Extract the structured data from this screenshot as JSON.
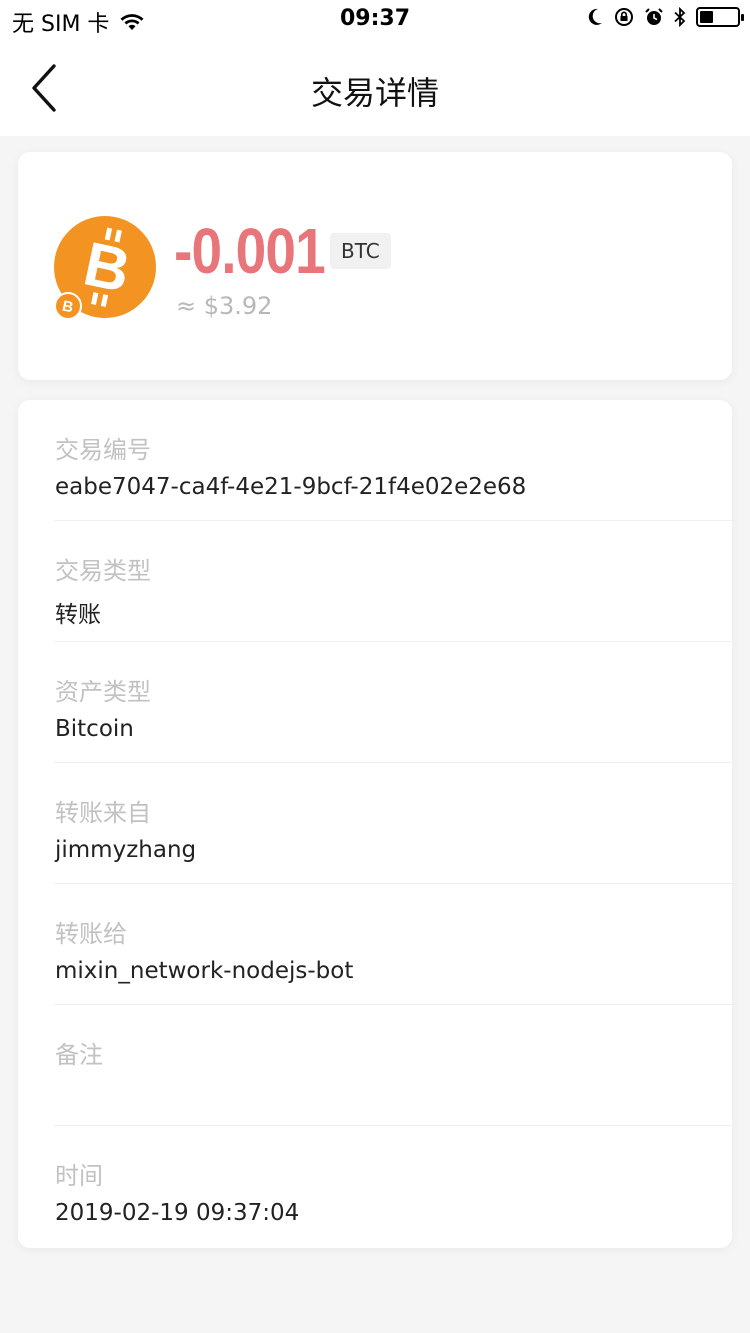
{
  "status_bar": {
    "carrier": "无 SIM 卡",
    "time": "09:37",
    "battery_level": 0.35,
    "icons": [
      "wifi-icon",
      "moon-icon",
      "orientation-lock-icon",
      "alarm-icon",
      "bluetooth-icon",
      "battery-icon"
    ]
  },
  "nav": {
    "title": "交易详情",
    "back_icon": "chevron-left-icon"
  },
  "asset": {
    "amount": "-0.001",
    "symbol": "BTC",
    "fiat": "≈ $3.92",
    "icon": "bitcoin-icon",
    "amount_color": "#e8757a",
    "coin_color": "#f39321"
  },
  "details": [
    {
      "label": "交易编号",
      "value": "eabe7047-ca4f-4e21-9bcf-21f4e02e2e68"
    },
    {
      "label": "交易类型",
      "value": "转账"
    },
    {
      "label": "资产类型",
      "value": "Bitcoin"
    },
    {
      "label": "转账来自",
      "value": "jimmyzhang"
    },
    {
      "label": "转账给",
      "value": "mixin_network-nodejs-bot"
    },
    {
      "label": "备注",
      "value": ""
    },
    {
      "label": "时间",
      "value": "2019-02-19 09:37:04"
    }
  ]
}
